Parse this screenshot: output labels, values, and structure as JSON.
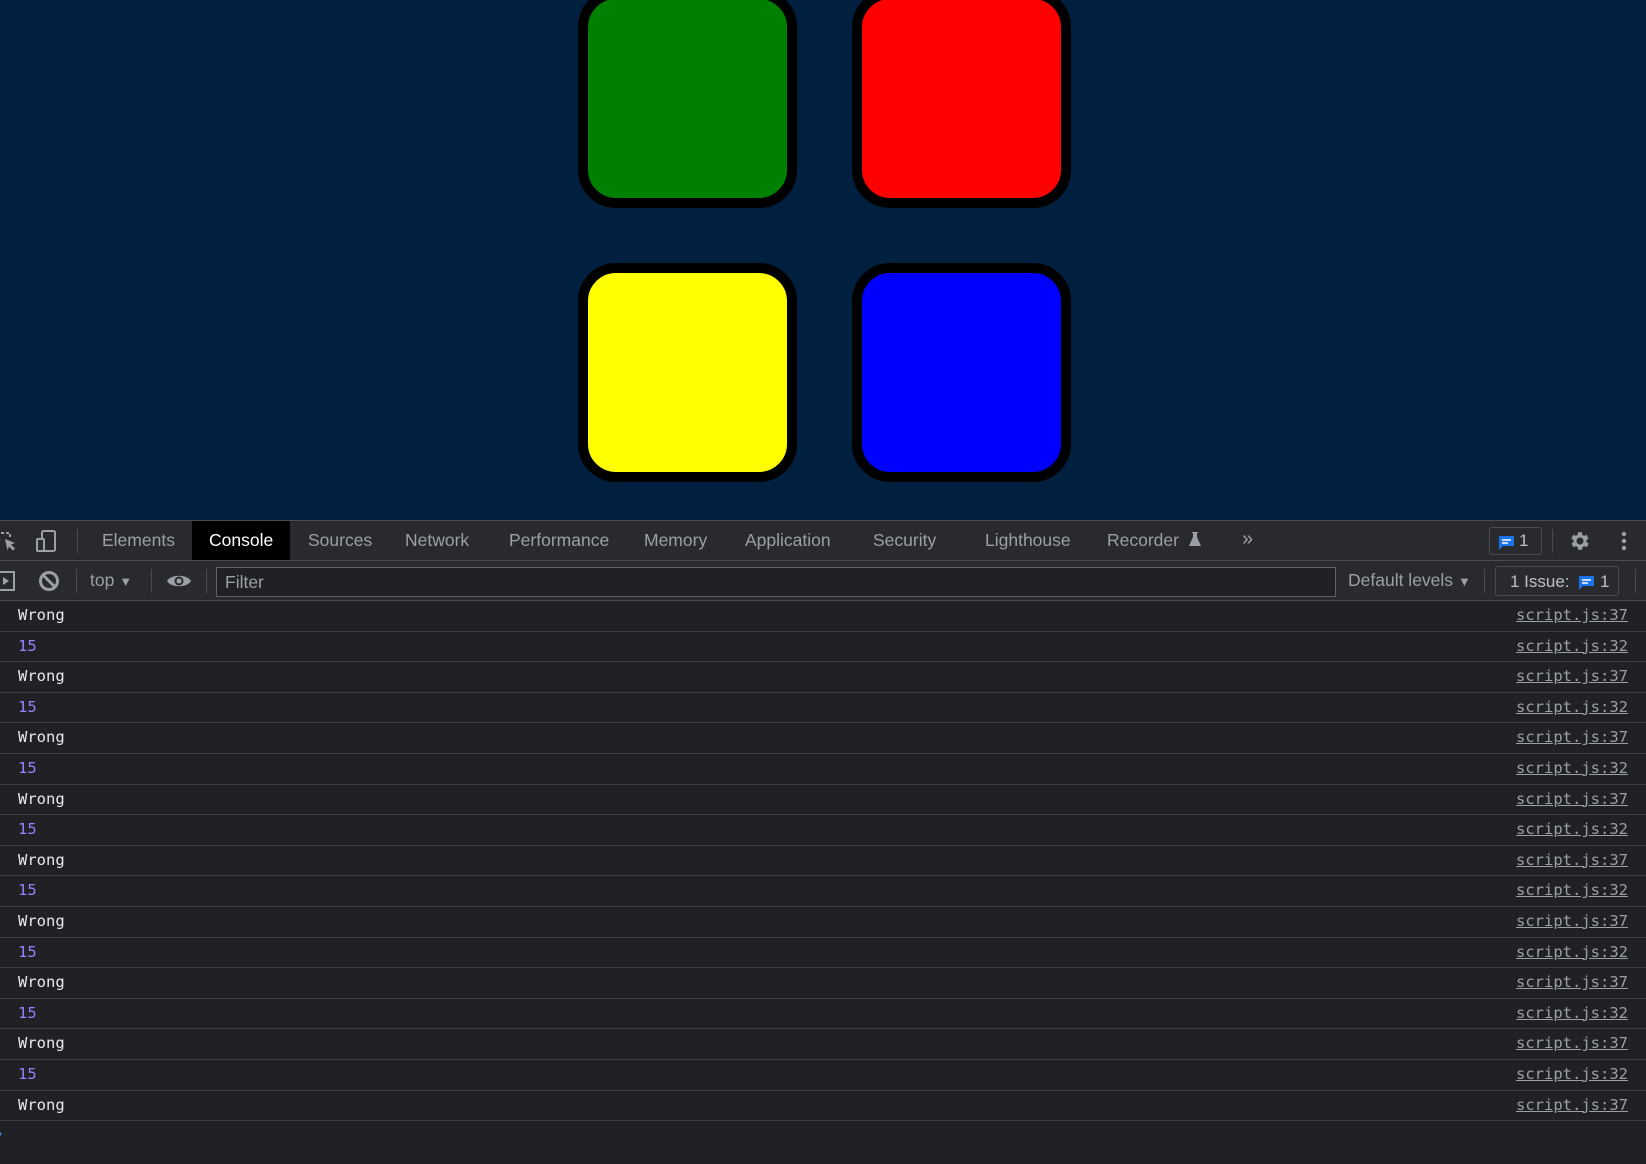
{
  "page": {
    "background": "#012040",
    "pads": [
      {
        "name": "green",
        "color": "#008000"
      },
      {
        "name": "red",
        "color": "#ff0000"
      },
      {
        "name": "yellow",
        "color": "#ffff00"
      },
      {
        "name": "blue",
        "color": "#0000ff"
      }
    ]
  },
  "devtools": {
    "tabs": [
      {
        "label": "Elements",
        "active": false
      },
      {
        "label": "Console",
        "active": true
      },
      {
        "label": "Sources",
        "active": false
      },
      {
        "label": "Network",
        "active": false
      },
      {
        "label": "Performance",
        "active": false
      },
      {
        "label": "Memory",
        "active": false
      },
      {
        "label": "Application",
        "active": false
      },
      {
        "label": "Security",
        "active": false
      },
      {
        "label": "Lighthouse",
        "active": false
      },
      {
        "label": "Recorder",
        "active": false
      }
    ],
    "more_tabs_icon": "»",
    "issues_count": "1",
    "toolbar": {
      "context": "top",
      "filter_placeholder": "Filter",
      "filter_value": "",
      "levels": "Default levels",
      "issue_label": "1 Issue:",
      "issue_count": "1"
    },
    "messages": [
      {
        "text": "Wrong",
        "type": "string",
        "source": "script.js:37"
      },
      {
        "text": "15",
        "type": "number",
        "source": "script.js:32"
      },
      {
        "text": "Wrong",
        "type": "string",
        "source": "script.js:37"
      },
      {
        "text": "15",
        "type": "number",
        "source": "script.js:32"
      },
      {
        "text": "Wrong",
        "type": "string",
        "source": "script.js:37"
      },
      {
        "text": "15",
        "type": "number",
        "source": "script.js:32"
      },
      {
        "text": "Wrong",
        "type": "string",
        "source": "script.js:37"
      },
      {
        "text": "15",
        "type": "number",
        "source": "script.js:32"
      },
      {
        "text": "Wrong",
        "type": "string",
        "source": "script.js:37"
      },
      {
        "text": "15",
        "type": "number",
        "source": "script.js:32"
      },
      {
        "text": "Wrong",
        "type": "string",
        "source": "script.js:37"
      },
      {
        "text": "15",
        "type": "number",
        "source": "script.js:32"
      },
      {
        "text": "Wrong",
        "type": "string",
        "source": "script.js:37"
      },
      {
        "text": "15",
        "type": "number",
        "source": "script.js:32"
      },
      {
        "text": "Wrong",
        "type": "string",
        "source": "script.js:37"
      },
      {
        "text": "15",
        "type": "number",
        "source": "script.js:32"
      },
      {
        "text": "Wrong",
        "type": "string",
        "source": "script.js:37"
      }
    ],
    "prompt_icon": "›"
  }
}
